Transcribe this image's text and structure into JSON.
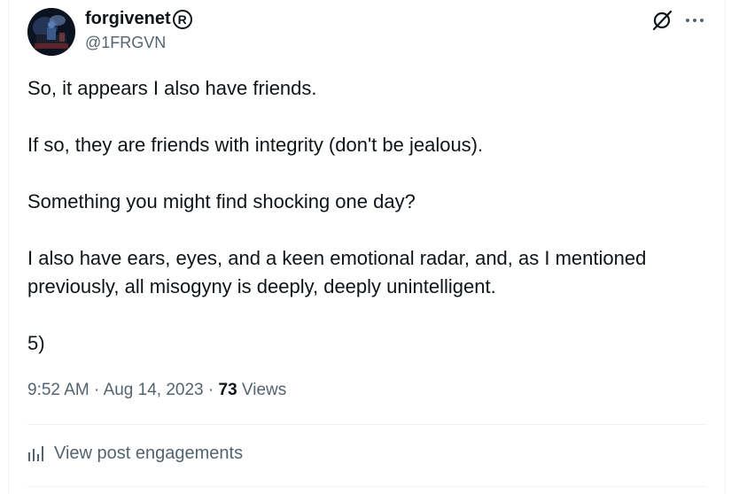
{
  "author": {
    "display_name": "forgivenet",
    "registered_mark": "R",
    "handle": "@1FRGVN"
  },
  "post": {
    "paragraphs": [
      "So, it appears I also have friends.",
      "If so, they are friends with integrity (don't be jealous).",
      "Something you might find shocking one day?",
      "I also have ears, eyes, and a keen emotional radar, and, as I mentioned previously, all misogyny is deeply, deeply unintelligent.",
      "5)"
    ]
  },
  "meta": {
    "time": "9:52 AM",
    "separator": " · ",
    "date": "Aug 14, 2023",
    "views_count": "73",
    "views_label": " Views"
  },
  "actions": {
    "view_engagements": "View post engagements"
  },
  "icons": {
    "grok": "grok-icon",
    "more": "more-icon",
    "engagements": "bar-chart-icon"
  },
  "colors": {
    "text_primary": "#0f1419",
    "text_secondary": "#536471",
    "divider": "#eff3f4"
  }
}
